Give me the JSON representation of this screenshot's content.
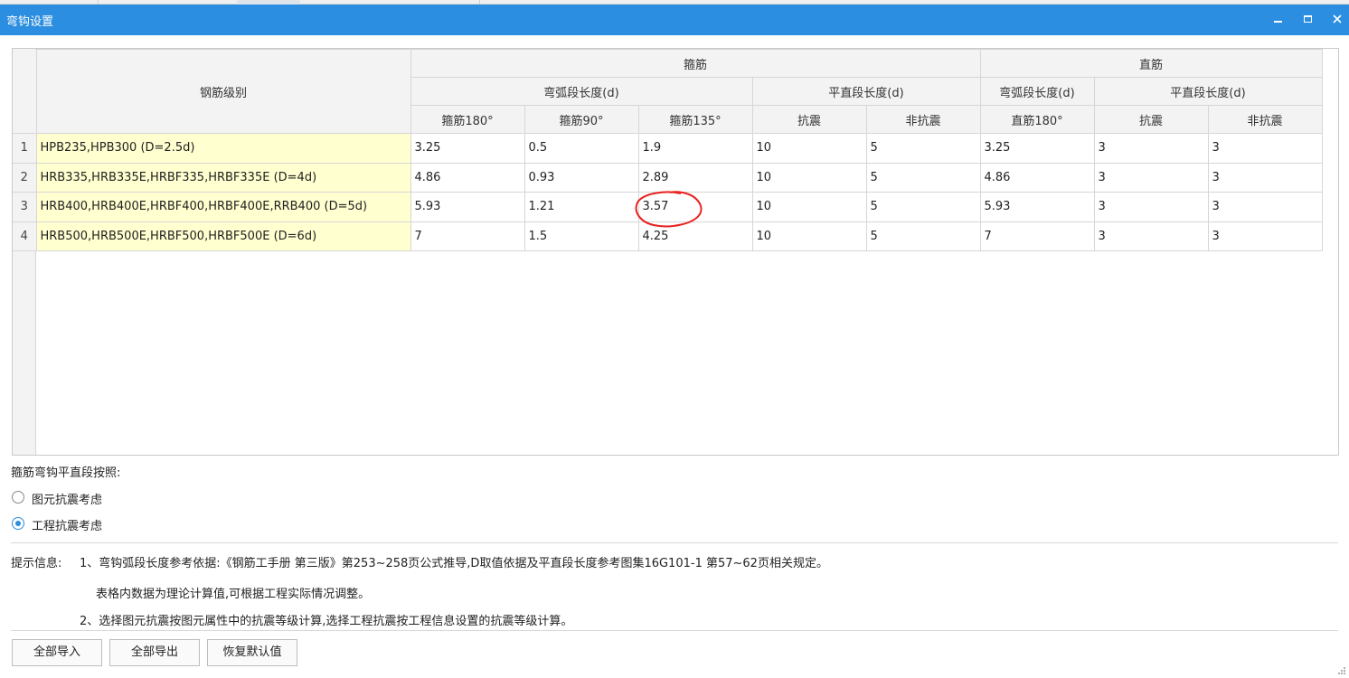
{
  "window": {
    "title": "弯钩设置"
  },
  "table": {
    "header": {
      "grade": "钢筋级别",
      "stirrup": "箍筋",
      "straight": "直筋",
      "arc_length": "弯弧段长度(d)",
      "flat_length": "平直段长度(d)",
      "straight_arc_length": "弯弧段长度(d)",
      "straight_flat_length": "平直段长度(d)",
      "cols": [
        "箍筋180°",
        "箍筋90°",
        "箍筋135°",
        "抗震",
        "非抗震",
        "直筋180°",
        "抗震",
        "非抗震"
      ]
    },
    "rows": [
      {
        "num": "1",
        "grade": "HPB235,HPB300 (D=2.5d)",
        "values": [
          "3.25",
          "0.5",
          "1.9",
          "10",
          "5",
          "3.25",
          "3",
          "3"
        ]
      },
      {
        "num": "2",
        "grade": "HRB335,HRB335E,HRBF335,HRBF335E (D=4d)",
        "values": [
          "4.86",
          "0.93",
          "2.89",
          "10",
          "5",
          "4.86",
          "3",
          "3"
        ]
      },
      {
        "num": "3",
        "grade": "HRB400,HRB400E,HRBF400,HRBF400E,RRB400 (D=5d)",
        "values": [
          "5.93",
          "1.21",
          "3.57",
          "10",
          "5",
          "5.93",
          "3",
          "3"
        ]
      },
      {
        "num": "4",
        "grade": "HRB500,HRB500E,HRBF500,HRBF500E (D=6d)",
        "values": [
          "7",
          "1.5",
          "4.25",
          "10",
          "5",
          "7",
          "3",
          "3"
        ]
      }
    ]
  },
  "options": {
    "label": "箍筋弯钩平直段按照:",
    "radio1": "图元抗震考虑",
    "radio2": "工程抗震考虑",
    "selected": "工程抗震考虑"
  },
  "hints": {
    "label": "提示信息:",
    "line1": "1、弯钩弧段长度参考依据:《钢筋工手册 第三版》第253~258页公式推导,D取值依据及平直段长度参考图集16G101-1 第57~62页相关规定。",
    "line2": "表格内数据为理论计算值,可根据工程实际情况调整。",
    "line3": "2、选择图元抗震按图元属性中的抗震等级计算,选择工程抗震按工程信息设置的抗震等级计算。"
  },
  "buttons": {
    "import_all": "全部导入",
    "export_all": "全部导出",
    "restore_default": "恢复默认值"
  },
  "colors": {
    "titlebar": "#2b8ee0",
    "grade_cell": "#ffffd0",
    "annotation": "#e8201e"
  }
}
